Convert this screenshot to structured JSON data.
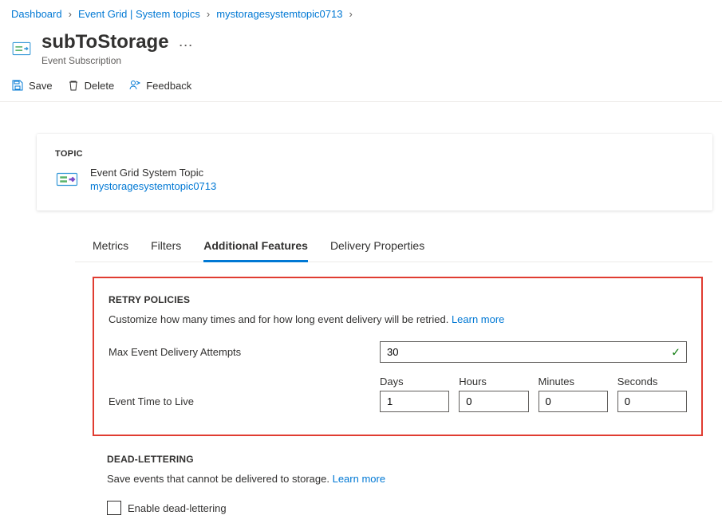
{
  "breadcrumbs": [
    "Dashboard",
    "Event Grid | System topics",
    "mystoragesystemtopic0713"
  ],
  "header": {
    "title": "subToStorage",
    "subtitle": "Event Subscription"
  },
  "toolbar": {
    "save": "Save",
    "delete": "Delete",
    "feedback": "Feedback"
  },
  "topic": {
    "label": "TOPIC",
    "type": "Event Grid System Topic",
    "name": "mystoragesystemtopic0713"
  },
  "tabs": {
    "metrics": "Metrics",
    "filters": "Filters",
    "additional": "Additional Features",
    "delivery": "Delivery Properties"
  },
  "retry": {
    "title": "RETRY POLICIES",
    "desc": "Customize how many times and for how long event delivery will be retried.",
    "learn_more": "Learn more",
    "max_label": "Max Event Delivery Attempts",
    "max_value": "30",
    "ttl_label": "Event Time to Live",
    "ttl": {
      "days_label": "Days",
      "days_value": "1",
      "hours_label": "Hours",
      "hours_value": "0",
      "minutes_label": "Minutes",
      "minutes_value": "0",
      "seconds_label": "Seconds",
      "seconds_value": "0"
    }
  },
  "dead_letter": {
    "title": "DEAD-LETTERING",
    "desc": "Save events that cannot be delivered to storage.",
    "learn_more": "Learn more",
    "enable_label": "Enable dead-lettering"
  }
}
